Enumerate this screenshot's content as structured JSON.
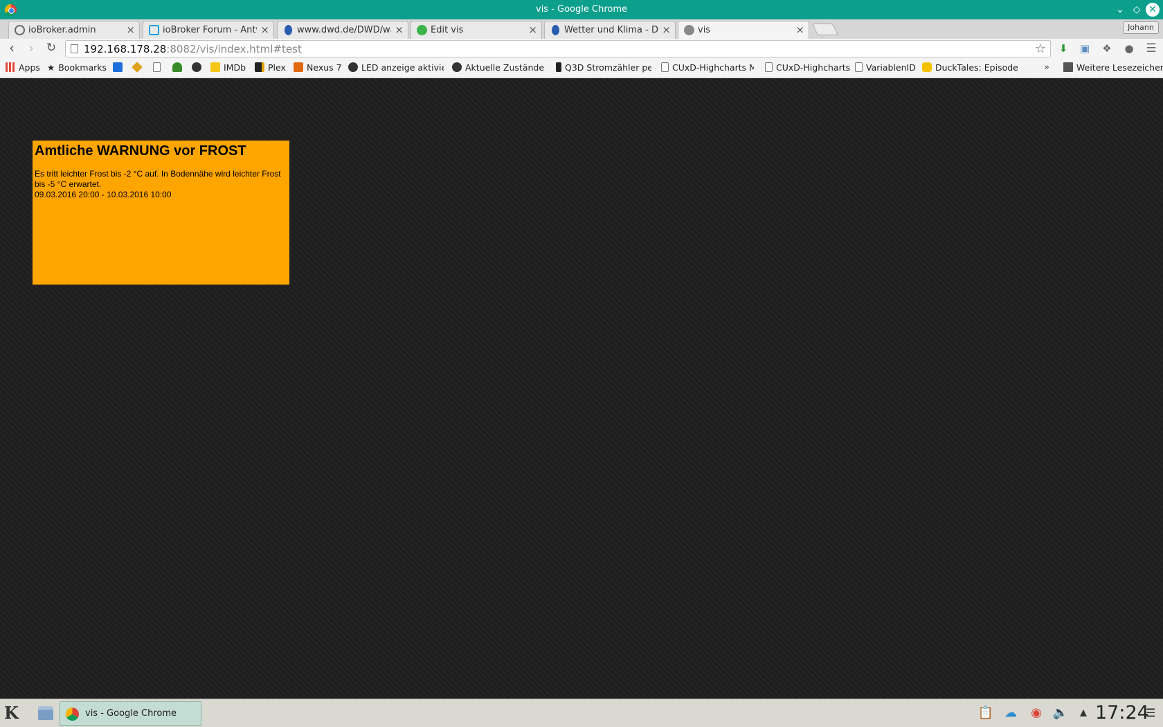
{
  "window": {
    "title": "vis - Google Chrome"
  },
  "tabs": [
    {
      "label": "ioBroker.admin",
      "icon": "gear-icon",
      "color": "#666666"
    },
    {
      "label": "ioBroker Forum - Antwor",
      "icon": "iobroker-icon",
      "color": "#1ca1e2"
    },
    {
      "label": "www.dwd.de/DWD/warn",
      "icon": "dwd-icon",
      "color": "#2a5db0"
    },
    {
      "label": "Edit vis",
      "icon": "vis-edit-icon",
      "color": "#3bb54a"
    },
    {
      "label": "Wetter und Klima - Deut",
      "icon": "dwd-icon",
      "color": "#2a5db0"
    },
    {
      "label": "vis",
      "icon": "globe-icon",
      "color": "#888888"
    }
  ],
  "profile": {
    "name": "Johann"
  },
  "address": {
    "host": "192.168.178.28",
    "rest": ":8082/vis/index.html#test"
  },
  "bookmarks": [
    {
      "label": "Apps",
      "icon": "apps-grid-icon",
      "color": "#e04a3c"
    },
    {
      "label": "Bookmarks",
      "icon": "star-icon",
      "color": "#555555"
    },
    {
      "label": "",
      "icon": "dsm-icon",
      "color": "#1e6fd9"
    },
    {
      "label": "",
      "icon": "diamond-icon",
      "color": "#e0a020"
    },
    {
      "label": "",
      "icon": "page-icon",
      "color": "#dddddd"
    },
    {
      "label": "",
      "icon": "plant-icon",
      "color": "#3a8a2a"
    },
    {
      "label": "",
      "icon": "plus-circle-icon",
      "color": "#333333"
    },
    {
      "label": "IMDb",
      "icon": "imdb-icon",
      "color": "#f5c518"
    },
    {
      "label": "Plex",
      "icon": "plex-icon",
      "color": "#222222"
    },
    {
      "label": "Nexus 7",
      "icon": "xda-icon",
      "color": "#e06a10"
    },
    {
      "label": "LED anzeige aktivier",
      "icon": "plus-circle-icon",
      "color": "#333333"
    },
    {
      "label": "Aktuelle Zustände in",
      "icon": "plus-circle-icon",
      "color": "#333333"
    },
    {
      "label": "Q3D Stromzähler pe",
      "icon": "q3d-icon",
      "color": "#222222"
    },
    {
      "label": "CUxD-Highcharts Mo",
      "icon": "page-icon",
      "color": "#dddddd"
    },
    {
      "label": "CUxD-Highcharts",
      "icon": "page-icon",
      "color": "#dddddd"
    },
    {
      "label": "VariablenID",
      "icon": "page-icon",
      "color": "#dddddd"
    },
    {
      "label": "DuckTales: Episoden",
      "icon": "ducktales-icon",
      "color": "#f5c000"
    }
  ],
  "bookmarks_more": "»",
  "other_bookmarks": "Weitere Lesezeichen",
  "warning": {
    "title": "Amtliche WARNUNG vor FROST",
    "description": "Es tritt leichter Frost bis -2 °C auf. In Bodennähe wird leichter Frost bis -5 °C erwartet.",
    "period": "09.03.2016 20:00 - 10.03.2016 10:00",
    "background": "#ffa500"
  },
  "taskbar": {
    "task_label": "vis - Google Chrome",
    "clock": "17:24"
  }
}
